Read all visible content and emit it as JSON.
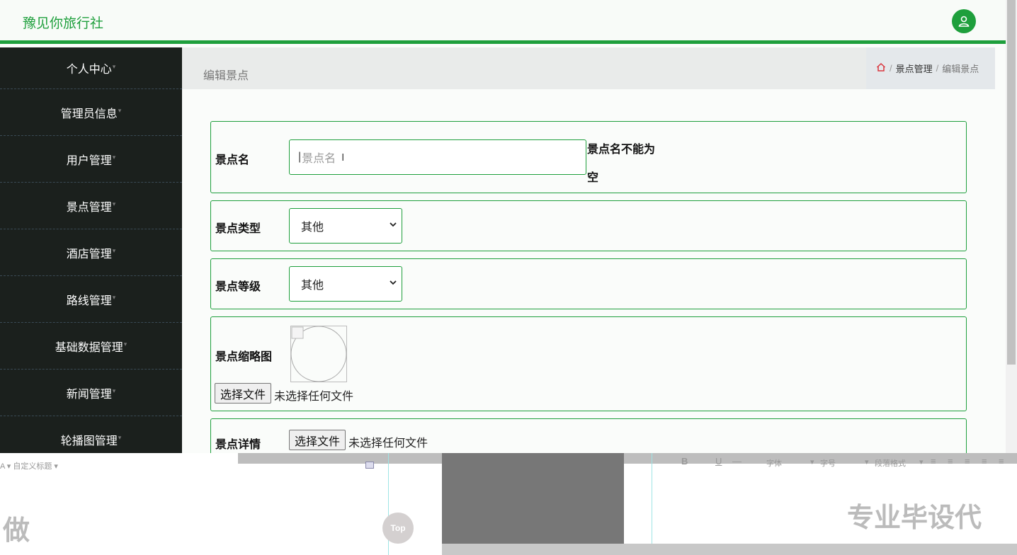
{
  "app": {
    "title": "豫见你旅行社"
  },
  "sidebar": {
    "items": [
      {
        "label": "个人中心"
      },
      {
        "label": "管理员信息"
      },
      {
        "label": "用户管理"
      },
      {
        "label": "景点管理"
      },
      {
        "label": "酒店管理"
      },
      {
        "label": "路线管理"
      },
      {
        "label": "基础数据管理"
      },
      {
        "label": "新闻管理"
      },
      {
        "label": "轮播图管理"
      }
    ]
  },
  "header": {
    "page_title": "编辑景点",
    "breadcrumb": [
      "景点管理",
      "编辑景点"
    ]
  },
  "form": {
    "name": {
      "label": "景点名",
      "placeholder": "景点名",
      "error": "景点名不能为空"
    },
    "type": {
      "label": "景点类型",
      "value": "其他"
    },
    "level": {
      "label": "景点等级",
      "value": "其他"
    },
    "thumb": {
      "label": "景点缩略图",
      "file_button": "选择文件",
      "file_status": "未选择任何文件"
    },
    "detail": {
      "label": "景点详情",
      "file_button": "选择文件",
      "file_status": "未选择任何文件"
    }
  },
  "overlay": {
    "left_toolbar": "A ▾  自定义标题 ▾",
    "left_big": "做",
    "top_button": "Top",
    "right_toolbar": [
      "B",
      "U",
      "字体",
      "字号",
      "段落格式"
    ],
    "right_big": "专业毕设代"
  },
  "colors": {
    "accent": "#1e9f3c",
    "sidebar_bg": "#1b201d"
  }
}
